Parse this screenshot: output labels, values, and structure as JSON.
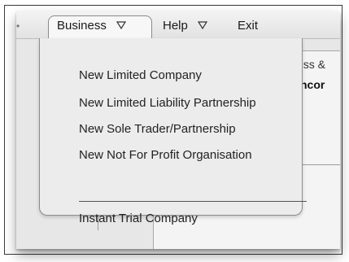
{
  "menubar": {
    "items": [
      {
        "label": "Business"
      },
      {
        "label": "Help"
      },
      {
        "label": "Exit"
      }
    ]
  },
  "business_menu": {
    "items": [
      {
        "label": "New Limited Company"
      },
      {
        "label": "New Limited Liability Partnership"
      },
      {
        "label": "New Sole Trader/Partnership"
      },
      {
        "label": "New Not For Profit Organisation"
      }
    ],
    "extra_items": [
      {
        "label": "Instant Trial Company"
      }
    ]
  },
  "background": {
    "partial_text_1": "ess &",
    "partial_text_2": "ncor"
  },
  "colors": {
    "menu_background": "#ececec",
    "menu_border": "#8d8d8d",
    "text": "#222222"
  },
  "icons": {
    "dropdown_arrow": "triangle-down-icon"
  }
}
